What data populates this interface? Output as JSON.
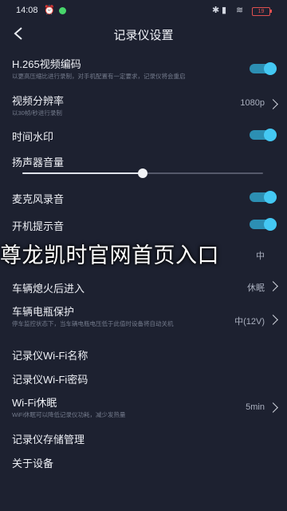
{
  "status_bar": {
    "time": "14:08",
    "battery": "19"
  },
  "header": {
    "title": "记录仪设置"
  },
  "settings": {
    "h265": {
      "label": "H.265视频编码",
      "desc": "以更高压缩比进行录制，对手机配置有一定要求，记录仪将会重启",
      "enabled": true
    },
    "resolution": {
      "label": "视频分辨率",
      "desc": "以30帧/秒进行录制",
      "value": "1080p"
    },
    "time_watermark": {
      "label": "时间水印",
      "enabled": true
    },
    "speaker_volume": {
      "label": "扬声器音量",
      "level": 0.5
    },
    "mic": {
      "label": "麦克风录音",
      "enabled": true
    },
    "boot_sound": {
      "label": "开机提示音",
      "enabled": true
    },
    "overlay_banner": {
      "text": "尊龙凯时官网首页入口",
      "value": "中"
    },
    "after_shutdown": {
      "label": "车辆熄火后进入",
      "value": "休眠"
    },
    "battery_protect": {
      "label": "车辆电瓶保护",
      "desc": "停车监控状态下，当车辆电瓶电压低于此值时设备将自动关机",
      "value": "中(12V)"
    },
    "wifi_name": {
      "label": "记录仪Wi-Fi名称"
    },
    "wifi_password": {
      "label": "记录仪Wi-Fi密码"
    },
    "wifi_sleep": {
      "label": "Wi-Fi休眠",
      "desc": "WiFi休眠可以降低记录仪功耗，减少发热量",
      "value": "5min"
    },
    "storage": {
      "label": "记录仪存储管理"
    },
    "about": {
      "label": "关于设备"
    }
  },
  "colors": {
    "background": "#1d2130",
    "toggle_on": "#44c8f3"
  }
}
